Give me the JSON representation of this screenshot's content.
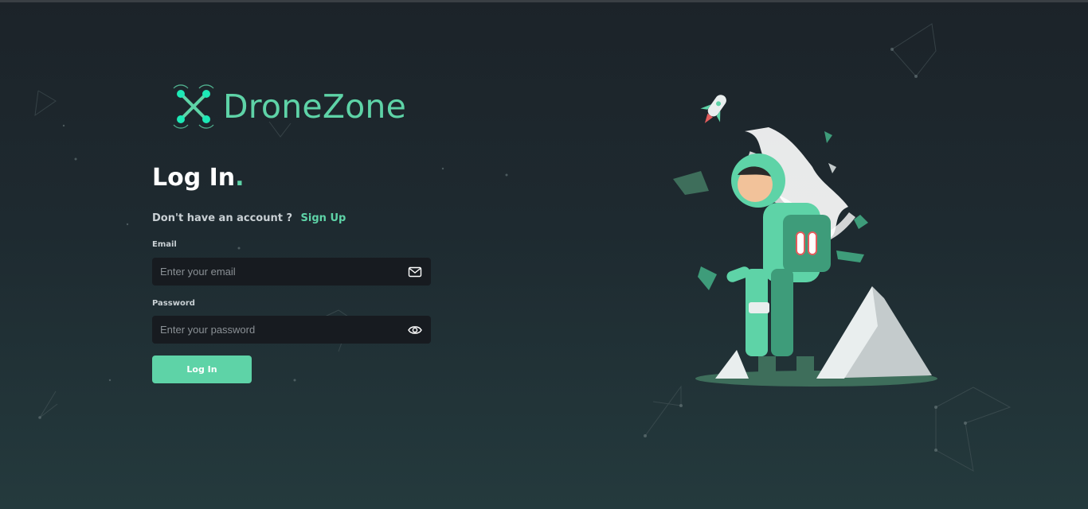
{
  "brand": {
    "name": "DroneZone",
    "logo_icon": "drone-icon"
  },
  "login": {
    "title": "Log In",
    "title_dot": ".",
    "no_account_text": "Don't have an account ?",
    "signup_link": "Sign Up",
    "email": {
      "label": "Email",
      "placeholder": "Enter your email",
      "value": "",
      "icon": "mail-icon"
    },
    "password": {
      "label": "Password",
      "placeholder": "Enter your password",
      "value": "",
      "icon": "eye-icon"
    },
    "submit_label": "Log In"
  },
  "colors": {
    "accent": "#5ed3a7",
    "background_top": "#1c2329",
    "background_bottom": "#243a3d",
    "input_bg": "#171b20"
  }
}
